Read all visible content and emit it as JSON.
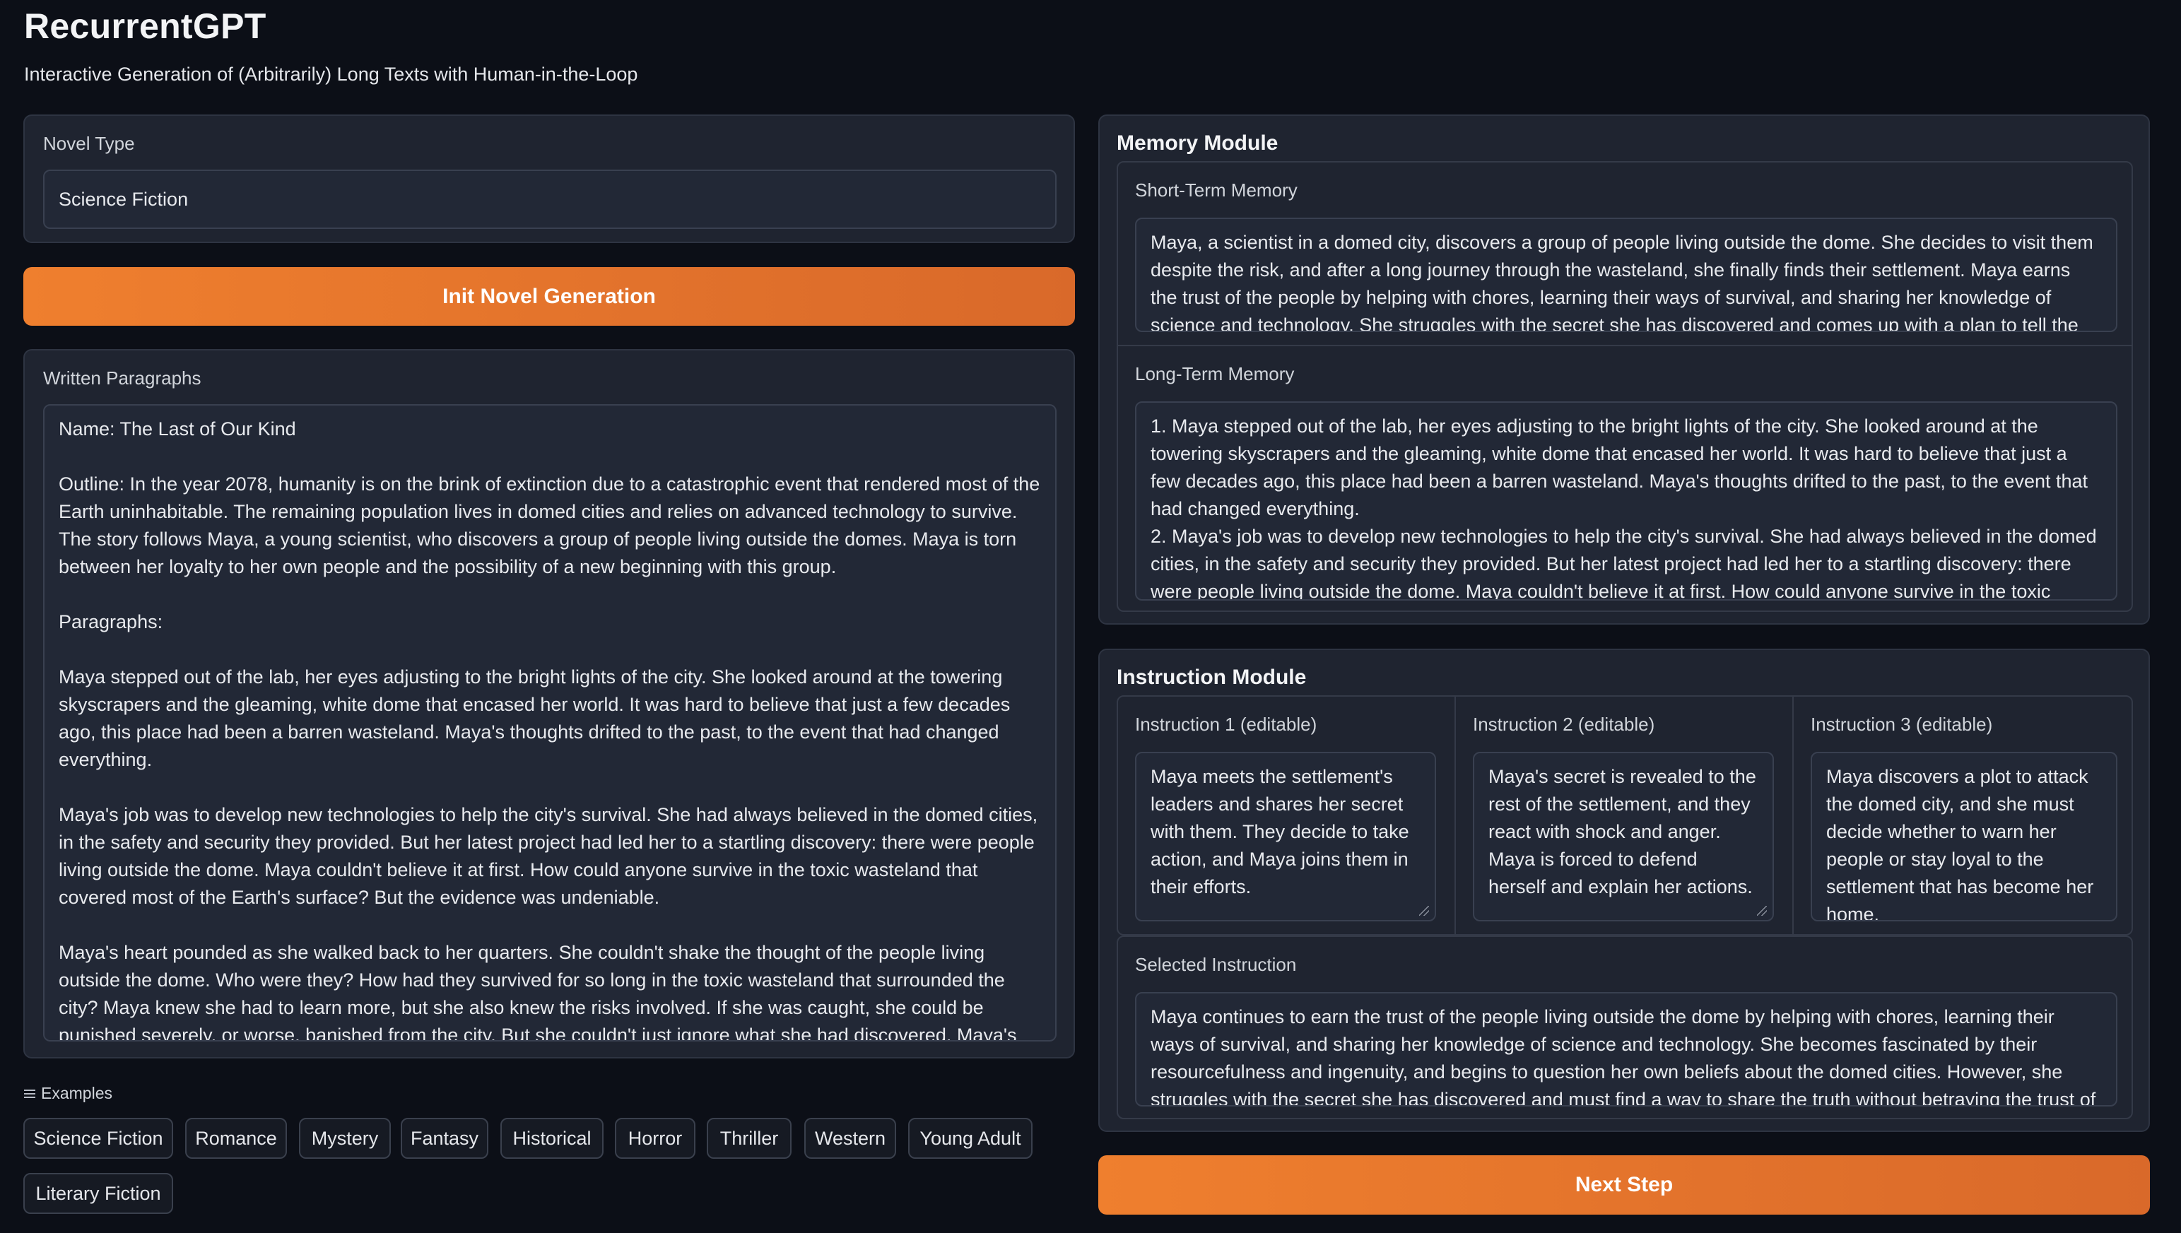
{
  "app": {
    "title": "RecurrentGPT",
    "subtitle": "Interactive Generation of (Arbitrarily) Long Texts with Human-in-the-Loop"
  },
  "novel_type": {
    "label": "Novel Type",
    "value": "Science Fiction"
  },
  "init_button": {
    "label": "Init Novel Generation"
  },
  "written": {
    "label": "Written Paragraphs",
    "text": "Name: The Last of Our Kind\n\nOutline: In the year 2078, humanity is on the brink of extinction due to a catastrophic event that rendered most of the Earth uninhabitable. The remaining population lives in domed cities and relies on advanced technology to survive. The story follows Maya, a young scientist, who discovers a group of people living outside the domes. Maya is torn between her loyalty to her own people and the possibility of a new beginning with this group.\n\nParagraphs:\n\nMaya stepped out of the lab, her eyes adjusting to the bright lights of the city. She looked around at the towering skyscrapers and the gleaming, white dome that encased her world. It was hard to believe that just a few decades ago, this place had been a barren wasteland. Maya's thoughts drifted to the past, to the event that had changed everything.\n\nMaya's job was to develop new technologies to help the city's survival. She had always believed in the domed cities, in the safety and security they provided. But her latest project had led her to a startling discovery: there were people living outside the dome. Maya couldn't believe it at first. How could anyone survive in the toxic wasteland that covered most of the Earth's surface? But the evidence was undeniable.\n\nMaya's heart pounded as she walked back to her quarters. She couldn't shake the thought of the people living outside the dome. Who were they? How had they survived for so long in the toxic wasteland that surrounded the city? Maya knew she had to learn more, but she also knew the risks involved. If she was caught, she could be punished severely, or worse, banished from the city. But she couldn't just ignore what she had discovered. Maya's mind raced with possibilities, each one more dangerous than the last. She had to be careful, to plan every detail meticulously."
  },
  "examples": {
    "label": "Examples",
    "items": [
      "Science Fiction",
      "Romance",
      "Mystery",
      "Fantasy",
      "Historical",
      "Horror",
      "Thriller",
      "Western",
      "Young Adult",
      "Literary Fiction"
    ]
  },
  "memory": {
    "title": "Memory Module",
    "short_label": "Short-Term Memory",
    "short_text": "Maya, a scientist in a domed city, discovers a group of people living outside the dome. She decides to visit them despite the risk, and after a long journey through the wasteland, she finally finds their settlement. Maya earns the trust of the people by helping with chores, learning their ways of survival, and sharing her knowledge of science and technology. She struggles with the secret she has discovered and comes up with a plan to tell the settlement's",
    "long_label": "Long-Term Memory",
    "long_text": "1. Maya stepped out of the lab, her eyes adjusting to the bright lights of the city. She looked around at the towering skyscrapers and the gleaming, white dome that encased her world. It was hard to believe that just a few decades ago, this place had been a barren wasteland. Maya's thoughts drifted to the past, to the event that had changed everything.\n2. Maya's job was to develop new technologies to help the city's survival. She had always believed in the domed cities, in the safety and security they provided. But her latest project had led her to a startling discovery: there were people living outside the dome. Maya couldn't believe it at first. How could anyone survive in the toxic wasteland"
  },
  "instruction": {
    "title": "Instruction Module",
    "items": [
      {
        "label": "Instruction 1 (editable)",
        "text": "Maya meets the settlement's leaders and shares her secret with them. They decide to take action, and Maya joins them in their efforts."
      },
      {
        "label": "Instruction 2 (editable)",
        "text": "Maya's secret is revealed to the rest of the settlement, and they react with shock and anger. Maya is forced to defend herself and explain her actions."
      },
      {
        "label": "Instruction 3 (editable)",
        "text": "Maya discovers a plot to attack the domed city, and she must decide whether to warn her people or stay loyal to the settlement that has become her home."
      }
    ],
    "selected_label": "Selected Instruction",
    "selected_text": "Maya continues to earn the trust of the people living outside the dome by helping with chores, learning their ways of survival, and sharing her knowledge of science and technology. She becomes fascinated by their resourcefulness and ingenuity, and begins to question her own beliefs about the domed cities. However, she struggles with the secret she has discovered and must find a way to share the truth without betraying the trust of the community."
  },
  "next_button": {
    "label": "Next Step"
  },
  "colors": {
    "accent": "#ef7f2e",
    "background": "#0c0f17",
    "panel": "#1f2430"
  }
}
